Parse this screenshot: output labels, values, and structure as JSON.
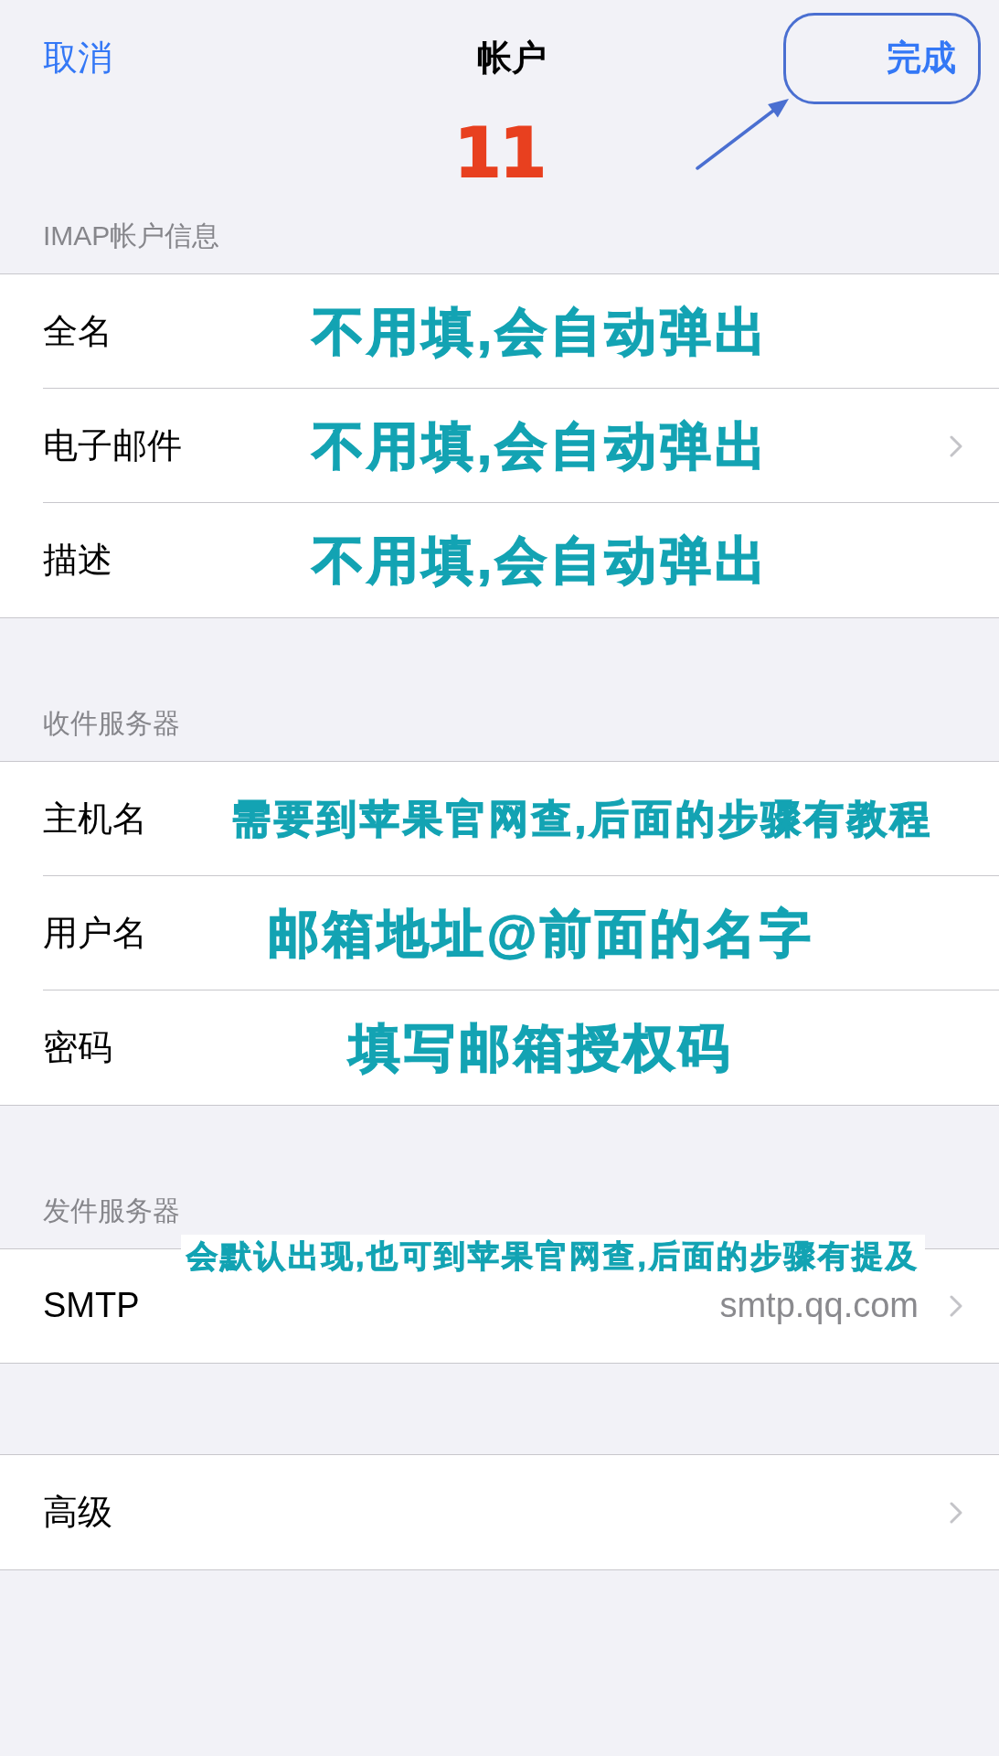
{
  "nav_bar": {
    "cancel": "取消",
    "title": "帐户",
    "done": "完成"
  },
  "step_label": "11",
  "sections": [
    {
      "header": "IMAP帐户信息",
      "rows": [
        {
          "label": "全名",
          "note": "不用填,会自动弹出",
          "disclosure": false
        },
        {
          "label": "电子邮件",
          "note": "不用填,会自动弹出",
          "disclosure": true
        },
        {
          "label": "描述",
          "note": "不用填,会自动弹出",
          "disclosure": false
        }
      ]
    },
    {
      "header": "收件服务器",
      "rows": [
        {
          "label": "主机名",
          "note": "需要到苹果官网查,后面的步骤有教程",
          "disclosure": false
        },
        {
          "label": "用户名",
          "note": "邮箱地址@前面的名字",
          "disclosure": false
        },
        {
          "label": "密码",
          "note": "填写邮箱授权码",
          "disclosure": false
        }
      ]
    },
    {
      "header": "发件服务器",
      "header_note": "会默认出现,也可到苹果官网查,后面的步骤有提及",
      "rows": [
        {
          "label": "SMTP",
          "value": "smtp.qq.com",
          "disclosure": true
        }
      ]
    },
    {
      "rows": [
        {
          "label": "高级",
          "disclosure": true
        }
      ]
    }
  ]
}
